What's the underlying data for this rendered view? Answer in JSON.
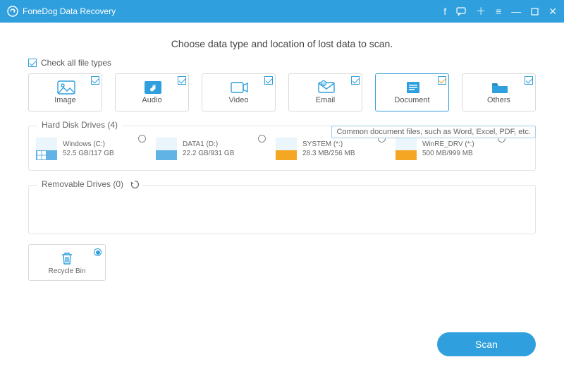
{
  "titlebar": {
    "app_name": "FoneDog Data Recovery"
  },
  "heading": "Choose data type and location of lost data to scan.",
  "check_all_label": "Check all file types",
  "types": [
    {
      "key": "image",
      "label": "Image",
      "checked": true,
      "selected": false
    },
    {
      "key": "audio",
      "label": "Audio",
      "checked": true,
      "selected": false
    },
    {
      "key": "video",
      "label": "Video",
      "checked": true,
      "selected": false
    },
    {
      "key": "email",
      "label": "Email",
      "checked": true,
      "selected": false
    },
    {
      "key": "document",
      "label": "Document",
      "checked": true,
      "selected": true
    },
    {
      "key": "others",
      "label": "Others",
      "checked": true,
      "selected": false
    }
  ],
  "tooltip": "Common document files, such as Word, Excel, PDF, etc.",
  "disk_section_title": "Hard Disk Drives (4)",
  "drives": [
    {
      "name": "Windows (C:)",
      "size": "52.5 GB/117 GB",
      "color": "blue",
      "win": true
    },
    {
      "name": "DATA1 (D:)",
      "size": "22.2 GB/931 GB",
      "color": "blue",
      "win": false
    },
    {
      "name": "SYSTEM (*:)",
      "size": "28.3 MB/256 MB",
      "color": "orange",
      "win": false
    },
    {
      "name": "WinRE_DRV (*:)",
      "size": "500 MB/999 MB",
      "color": "orange",
      "win": false
    }
  ],
  "removable_section_title": "Removable Drives (0)",
  "recycle_label": "Recycle Bin",
  "scan_label": "Scan"
}
